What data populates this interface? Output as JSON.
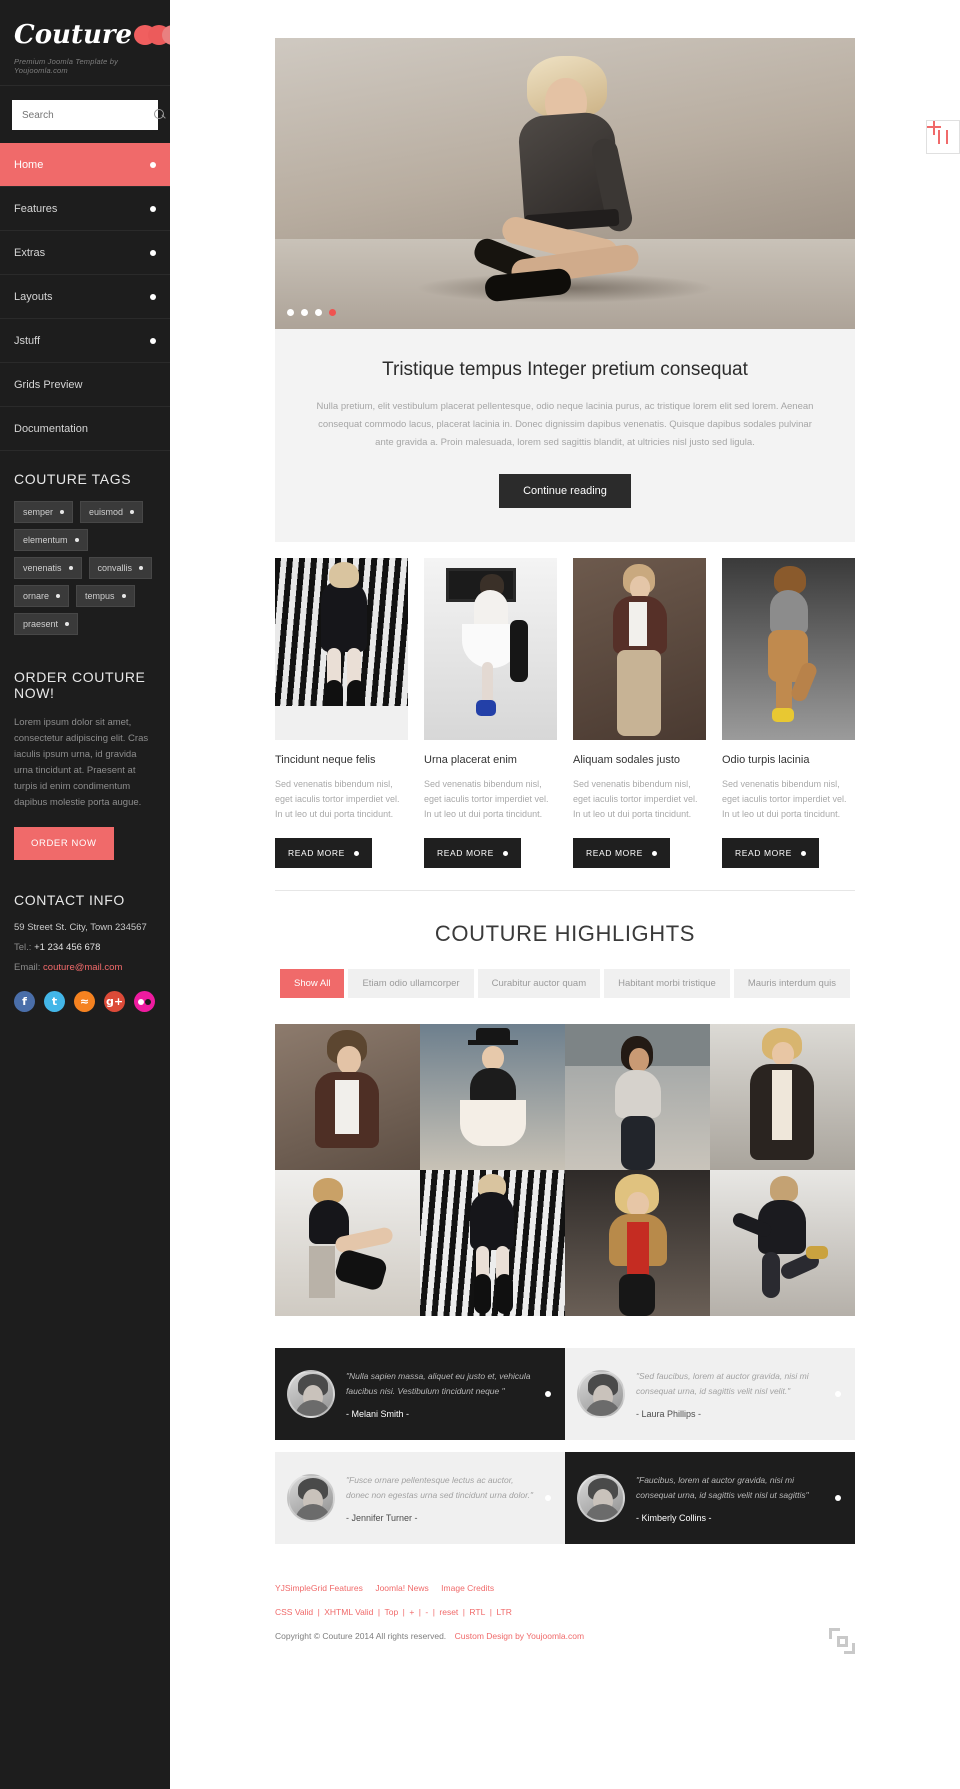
{
  "brand": {
    "name": "Couture",
    "tagline": "Premium Joomla Template by Youjoomla.com"
  },
  "search": {
    "placeholder": "Search",
    "value": "",
    "icon": "search-icon"
  },
  "nav": {
    "items": [
      {
        "label": "Home",
        "active": true,
        "has_bullet": true
      },
      {
        "label": "Features",
        "active": false,
        "has_bullet": true
      },
      {
        "label": "Extras",
        "active": false,
        "has_bullet": true
      },
      {
        "label": "Layouts",
        "active": false,
        "has_bullet": true
      },
      {
        "label": "Jstuff",
        "active": false,
        "has_bullet": true
      },
      {
        "label": "Grids Preview",
        "active": false,
        "has_bullet": false
      },
      {
        "label": "Documentation",
        "active": false,
        "has_bullet": false
      }
    ]
  },
  "tags_widget": {
    "title": "COUTURE TAGS",
    "tags": [
      "semper",
      "euismod",
      "elementum",
      "venenatis",
      "convallis",
      "ornare",
      "tempus",
      "praesent"
    ]
  },
  "order_widget": {
    "title": "ORDER COUTURE NOW!",
    "body": "Lorem ipsum dolor sit amet, consectetur adipiscing elit. Cras iaculis ipsum urna, id gravida urna tincidunt at. Praesent at turpis id enim condimentum dapibus molestie porta augue.",
    "button": "ORDER NOW"
  },
  "contact_widget": {
    "title": "CONTACT INFO",
    "address": "59 Street St. City, Town 234567",
    "tel_label": "Tel.:",
    "tel_value": "+1 234 456 678",
    "email_label": "Email:",
    "email_value": "couture@mail.com",
    "social": [
      {
        "name": "facebook-icon",
        "glyph": "f",
        "color": "#4a6ea9"
      },
      {
        "name": "twitter-icon",
        "glyph": "t",
        "color": "#43b6e8"
      },
      {
        "name": "rss-icon",
        "glyph": "◠",
        "color": "#f58220"
      },
      {
        "name": "google-plus-icon",
        "glyph": "g+",
        "color": "#dc4a38"
      },
      {
        "name": "flickr-icon",
        "glyph": "",
        "color": "#ef1ba0"
      }
    ]
  },
  "slider": {
    "dots": [
      {
        "active": false
      },
      {
        "active": false
      },
      {
        "active": false
      },
      {
        "active": true
      }
    ]
  },
  "intro": {
    "heading": "Tristique tempus Integer pretium consequat",
    "body": "Nulla pretium, elit vestibulum placerat pellentesque, odio neque lacinia purus, ac tristique lorem elit sed lorem. Aenean consequat commodo lacus, placerat lacinia in. Donec dignissim dapibus venenatis. Quisque dapibus sodales pulvinar ante gravida a. Proin malesuada, lorem sed sagittis blandit, at ultricies nisl justo sed ligula.",
    "button": "Continue reading"
  },
  "cards": [
    {
      "title": "Tincidunt neque felis",
      "body": "Sed venenatis bibendum nisl, eget iaculis tortor imperdiet vel. In ut leo ut dui porta tincidunt.",
      "button": "READ MORE"
    },
    {
      "title": "Urna placerat enim",
      "body": "Sed venenatis bibendum nisl, eget iaculis tortor imperdiet vel. In ut leo ut dui porta tincidunt.",
      "button": "READ MORE"
    },
    {
      "title": "Aliquam sodales justo",
      "body": "Sed venenatis bibendum nisl, eget iaculis tortor imperdiet vel. In ut leo ut dui porta tincidunt.",
      "button": "READ MORE"
    },
    {
      "title": "Odio turpis lacinia",
      "body": "Sed venenatis bibendum nisl, eget iaculis tortor imperdiet vel. In ut leo ut dui porta tincidunt.",
      "button": "READ MORE"
    }
  ],
  "highlights": {
    "title": "COUTURE HIGHLIGHTS",
    "filters": [
      {
        "label": "Show All",
        "active": true
      },
      {
        "label": "Etiam odio ullamcorper",
        "active": false
      },
      {
        "label": "Curabitur auctor quam",
        "active": false
      },
      {
        "label": "Habitant morbi tristique",
        "active": false
      },
      {
        "label": "Mauris interdum quis",
        "active": false
      }
    ]
  },
  "testimonials": [
    {
      "theme": "dark",
      "quote": "\"Nulla sapien massa, aliquet eu justo et, vehicula faucibus nisi. Vestibulum tincidunt neque \"",
      "author": "- Melani Smith -"
    },
    {
      "theme": "light",
      "quote": "\"Sed faucibus, lorem at auctor gravida, nisi mi consequat urna, id sagittis velit nisl velit.\"",
      "author": "- Laura Phillips -"
    },
    {
      "theme": "light",
      "quote": "\"Fusce ornare pellentesque lectus ac auctor, donec non egestas urna sed tincidunt urna dolor.\"",
      "author": "- Jennifer Turner -"
    },
    {
      "theme": "dark",
      "quote": "\"Faucibus, lorem at auctor gravida, nisi mi consequat urna, id sagittis velit nisl ut sagittis\"",
      "author": "- Kimberly Collins -"
    }
  ],
  "footer": {
    "row1": [
      "YJSimpleGrid Features",
      "Joomla! News",
      "Image Credits"
    ],
    "row2": [
      "CSS Valid",
      "XHTML Valid",
      "Top",
      "+",
      "-",
      "reset",
      "RTL",
      "LTR"
    ],
    "copyright": "Copyright © Couture 2014 All rights reserved.",
    "design_link": "Custom Design by Youjoomla.com",
    "separator": "|"
  },
  "side_tab": {
    "icon": "settings-sliders-icon"
  },
  "colors": {
    "accent": "#f06a6a",
    "sidebar_bg": "#1d1d1d",
    "dark_btn": "#1f1f1f",
    "panel_bg": "#f3f3f3"
  }
}
